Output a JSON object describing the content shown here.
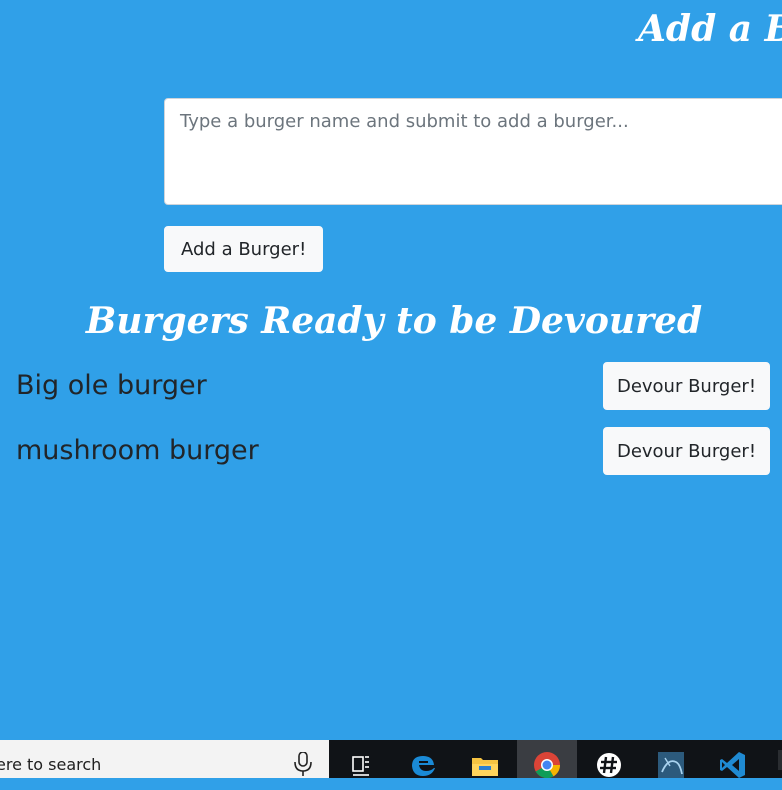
{
  "add_section": {
    "heading": "Add a B",
    "textarea_placeholder": "Type a burger name and submit to add a burger...",
    "submit_label": "Add a Burger!"
  },
  "devour_section": {
    "heading": "Burgers Ready to be Devoured",
    "burgers": [
      {
        "name": "Big ole burger",
        "button_label": "Devour Burger!"
      },
      {
        "name": "mushroom burger",
        "button_label": "Devour Burger!"
      }
    ]
  },
  "taskbar": {
    "search_text": "ere to search",
    "icons": [
      "task-view-icon",
      "edge-icon",
      "file-explorer-icon",
      "chrome-icon",
      "slack-icon",
      "mysql-workbench-icon",
      "vscode-icon"
    ]
  },
  "colors": {
    "page_background": "#30a0e8",
    "heading_text": "#ffffff",
    "button_background": "#f8f9fa",
    "taskbar_background": "#101317"
  }
}
